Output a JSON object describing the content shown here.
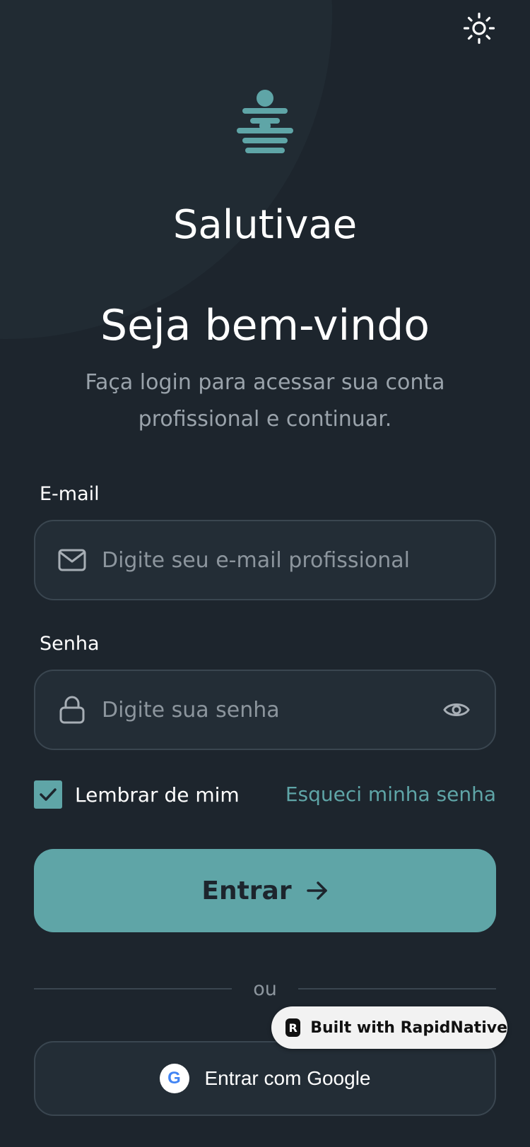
{
  "app": {
    "brand": "Salutivae"
  },
  "theme": {
    "icon": "sun-icon"
  },
  "header": {
    "title": "Seja bem-vindo",
    "subtitle": "Faça login para acessar sua conta profissional e continuar."
  },
  "form": {
    "email": {
      "label": "E-mail",
      "placeholder": "Digite seu e-mail profissional",
      "value": "",
      "icon": "mail-icon"
    },
    "password": {
      "label": "Senha",
      "placeholder": "Digite sua senha",
      "value": "",
      "icon": "lock-icon",
      "toggle_icon": "eye-icon"
    },
    "remember": {
      "label": "Lembrar de mim",
      "checked": true
    },
    "forgot_link": "Esqueci minha senha",
    "submit_label": "Entrar",
    "divider_text": "ou",
    "google_label": "Entrar com Google",
    "google_glyph": "G"
  },
  "badge": {
    "label": "Built with RapidNative",
    "glyph": "R"
  },
  "colors": {
    "background": "#1d252d",
    "accent": "#5fa5a7",
    "field_bg": "#232d36",
    "border": "#3a4650",
    "muted_text": "#9aa3ab"
  }
}
